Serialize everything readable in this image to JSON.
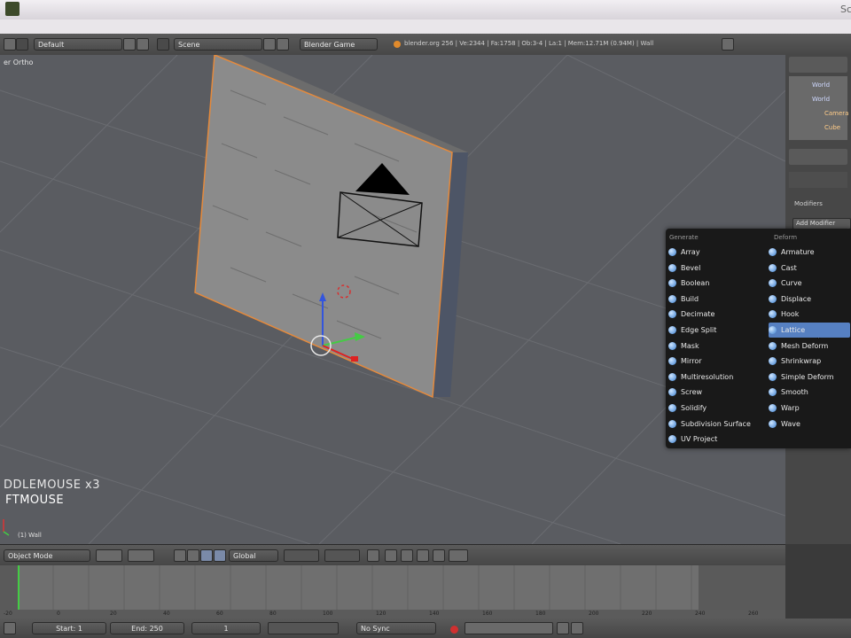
{
  "window": {
    "title_fragment": "Sc"
  },
  "infobar": {
    "layout_value": "Default",
    "scene_value": "Scene",
    "engine_value": "Blender Game",
    "stats": "blender.org 256 | Ve:2344 | Fa:1758 | Ob:3-4 | La:1 | Mem:12.71M (0.94M) | Wall"
  },
  "viewport": {
    "view_label": "er Ortho",
    "hint_line1": "DDLEMOUSE x3",
    "hint_line2": "FTMOUSE",
    "object_label": "(1) Wall",
    "colors": {
      "background": "#5a5c61",
      "selection": "#e58a3c"
    }
  },
  "outliner": {
    "items": [
      "World",
      "World",
      "Camera",
      "Cube"
    ]
  },
  "properties": {
    "panel_title": "Modifiers",
    "add_modifier_label": "Add Modifier"
  },
  "modifier_menu": {
    "generate_header": "Generate",
    "deform_header": "Deform",
    "generate": [
      "Array",
      "Bevel",
      "Boolean",
      "Build",
      "Decimate",
      "Edge Split",
      "Mask",
      "Mirror",
      "Multiresolution",
      "Screw",
      "Solidify",
      "Subdivision Surface",
      "UV Project"
    ],
    "deform": [
      "Armature",
      "Cast",
      "Curve",
      "Displace",
      "Hook",
      "Lattice",
      "Mesh Deform",
      "Shrinkwrap",
      "Simple Deform",
      "Smooth",
      "Warp",
      "Wave"
    ],
    "highlighted": "Lattice"
  },
  "header3d": {
    "mode_value": "Object Mode",
    "orientation_value": "Global"
  },
  "timeline": {
    "ruler_ticks": [
      "-20",
      "0",
      "20",
      "40",
      "60",
      "80",
      "100",
      "120",
      "140",
      "160",
      "180",
      "200",
      "220",
      "240",
      "260"
    ],
    "start_label": "Start: 1",
    "end_label": "End: 250",
    "current_frame": "1",
    "sync_value": "No Sync"
  }
}
